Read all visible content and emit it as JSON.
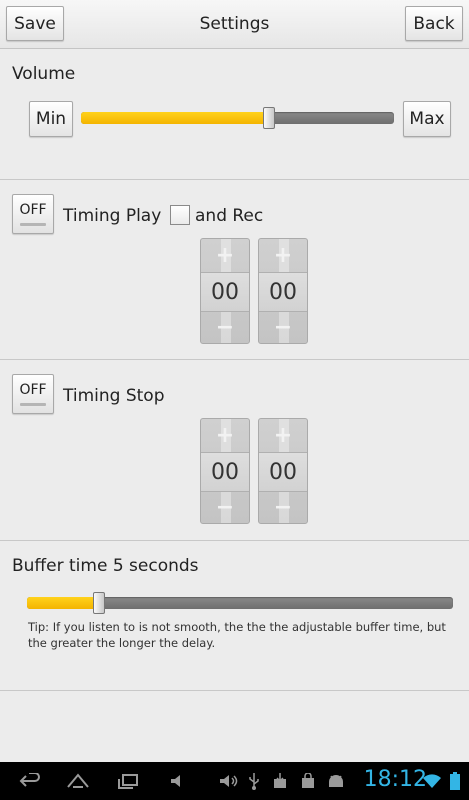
{
  "header": {
    "title": "Settings",
    "save_label": "Save",
    "back_label": "Back"
  },
  "volume": {
    "label": "Volume",
    "min_label": "Min",
    "max_label": "Max",
    "level_fraction": 0.6
  },
  "timing_play": {
    "toggle_label": "OFF",
    "label": "Timing Play",
    "checkbox_label": "and Rec",
    "hours": "00",
    "minutes": "00",
    "plus_symbol": "+",
    "minus_symbol": "−"
  },
  "timing_stop": {
    "toggle_label": "OFF",
    "label": "Timing Stop",
    "hours": "00",
    "minutes": "00",
    "plus_symbol": "+",
    "minus_symbol": "−"
  },
  "buffer": {
    "label": "Buffer time 5 seconds",
    "level_fraction": 0.17,
    "tip": "Tip: If you listen to is not smooth, the the the adjustable buffer time, but the greater the longer the delay."
  },
  "system_bar": {
    "time": "18:12",
    "accent_color": "#33b5e5",
    "icons": [
      "back-icon",
      "home-icon",
      "recent-apps-icon",
      "volume-down-icon",
      "volume-up-icon",
      "usb-icon",
      "download-icon",
      "bag-icon",
      "android-debug-icon",
      "wifi-icon",
      "battery-icon"
    ]
  }
}
